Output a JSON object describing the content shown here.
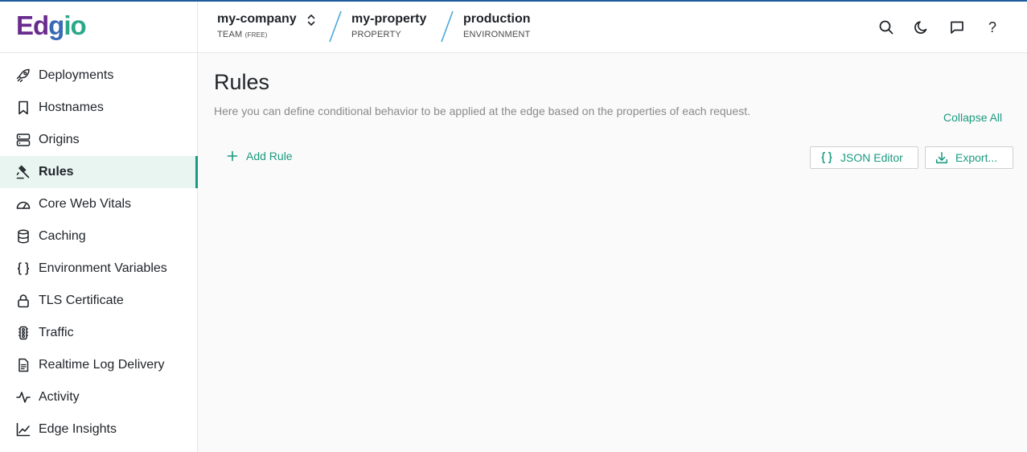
{
  "brand": {
    "logo_part1": "Ed",
    "logo_part2": "g",
    "logo_part3": "io",
    "colors": {
      "purple": "#6a2b8f",
      "blue": "#3a6ab3",
      "teal": "#2aa88a",
      "accent": "#1a9a80",
      "top_strip": "#1e5a9e"
    }
  },
  "breadcrumb": {
    "team": {
      "name": "my-company",
      "sub": "TEAM",
      "plan": "(FREE)"
    },
    "property": {
      "name": "my-property",
      "sub": "PROPERTY"
    },
    "environment": {
      "name": "production",
      "sub": "ENVIRONMENT"
    }
  },
  "header_icons": [
    "search-icon",
    "moon-icon",
    "chat-icon",
    "help-icon"
  ],
  "help_glyph": "?",
  "sidebar": {
    "items": [
      {
        "label": "Deployments",
        "icon": "rocket-icon"
      },
      {
        "label": "Hostnames",
        "icon": "bookmark-icon"
      },
      {
        "label": "Origins",
        "icon": "server-icon"
      },
      {
        "label": "Rules",
        "icon": "gavel-icon",
        "active": true
      },
      {
        "label": "Core Web Vitals",
        "icon": "gauge-icon"
      },
      {
        "label": "Caching",
        "icon": "database-icon"
      },
      {
        "label": "Environment Variables",
        "icon": "braces-icon"
      },
      {
        "label": "TLS Certificate",
        "icon": "lock-icon"
      },
      {
        "label": "Traffic",
        "icon": "traffic-light-icon"
      },
      {
        "label": "Realtime Log Delivery",
        "icon": "document-icon"
      },
      {
        "label": "Activity",
        "icon": "activity-icon"
      },
      {
        "label": "Edge Insights",
        "icon": "chart-line-icon"
      }
    ]
  },
  "main": {
    "title": "Rules",
    "description": "Here you can define conditional behavior to be applied at the edge based on the properties of each request.",
    "collapse_all": "Collapse All",
    "add_rule": "Add Rule",
    "json_editor": "JSON Editor",
    "export": "Export..."
  }
}
